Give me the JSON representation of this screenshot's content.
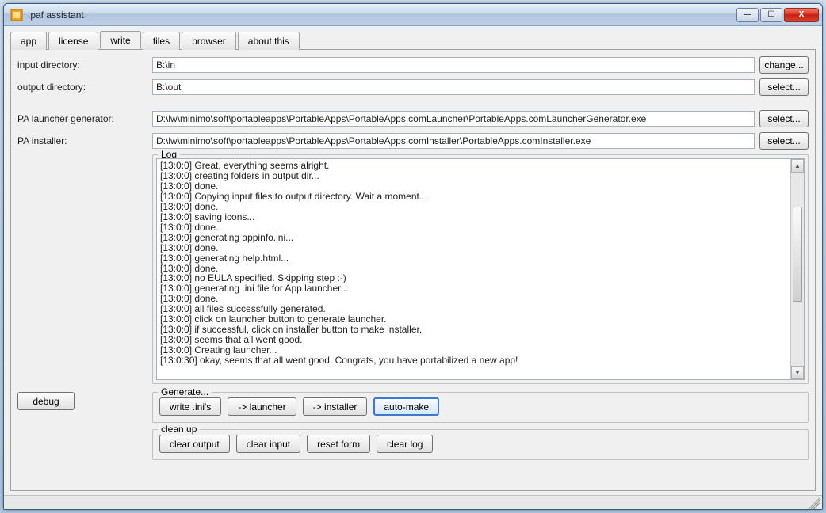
{
  "window": {
    "title": ".paf assistant"
  },
  "winbuttons": {
    "min": "—",
    "max": "☐",
    "close": "X"
  },
  "tabs": {
    "app": "app",
    "license": "license",
    "write": "write",
    "files": "files",
    "browser": "browser",
    "about": "about this"
  },
  "fields": {
    "input_dir_label": "input directory:",
    "input_dir_value": "B:\\in",
    "input_dir_btn": "change...",
    "output_dir_label": "output directory:",
    "output_dir_value": "B:\\out",
    "output_dir_btn": "select...",
    "launcher_gen_label": "PA launcher generator:",
    "launcher_gen_value": "D:\\lw\\minimo\\soft\\portableapps\\PortableApps\\PortableApps.comLauncher\\PortableApps.comLauncherGenerator.exe",
    "launcher_gen_btn": "select...",
    "installer_label": "PA installer:",
    "installer_value": "D:\\lw\\minimo\\soft\\portableapps\\PortableApps\\PortableApps.comInstaller\\PortableApps.comInstaller.exe",
    "installer_btn": "select..."
  },
  "log": {
    "legend": "Log",
    "lines": [
      "[13:0:0] Great, everything seems alright.",
      "[13:0:0] creating folders in output dir...",
      "[13:0:0] done.",
      "[13:0:0] Copying input files to output directory. Wait a moment...",
      "[13:0:0] done.",
      "[13:0:0] saving icons...",
      "[13:0:0] done.",
      "[13:0:0] generating appinfo.ini...",
      "[13:0:0] done.",
      "[13:0:0] generating help.html...",
      "[13:0:0] done.",
      "[13:0:0] no EULA specified. Skipping step :-)",
      "[13:0:0] generating .ini file for App launcher...",
      "[13:0:0] done.",
      "[13:0:0] all files successfully generated.",
      "[13:0:0] click on launcher button to generate launcher.",
      "[13:0:0] if successful, click on installer button to make installer.",
      "[13:0:0] seems that all went good.",
      "[13:0:0] Creating launcher...",
      "[13:0:30] okay, seems that all went good. Congrats, you have portabilized a new app!"
    ]
  },
  "debug_btn": "debug",
  "generate": {
    "legend": "Generate...",
    "write_inis": "write .ini's",
    "to_launcher": "-> launcher",
    "to_installer": "-> installer",
    "automake": "auto-make"
  },
  "cleanup": {
    "legend": "clean up",
    "clear_output": "clear output",
    "clear_input": "clear input",
    "reset_form": "reset form",
    "clear_log": "clear log"
  }
}
